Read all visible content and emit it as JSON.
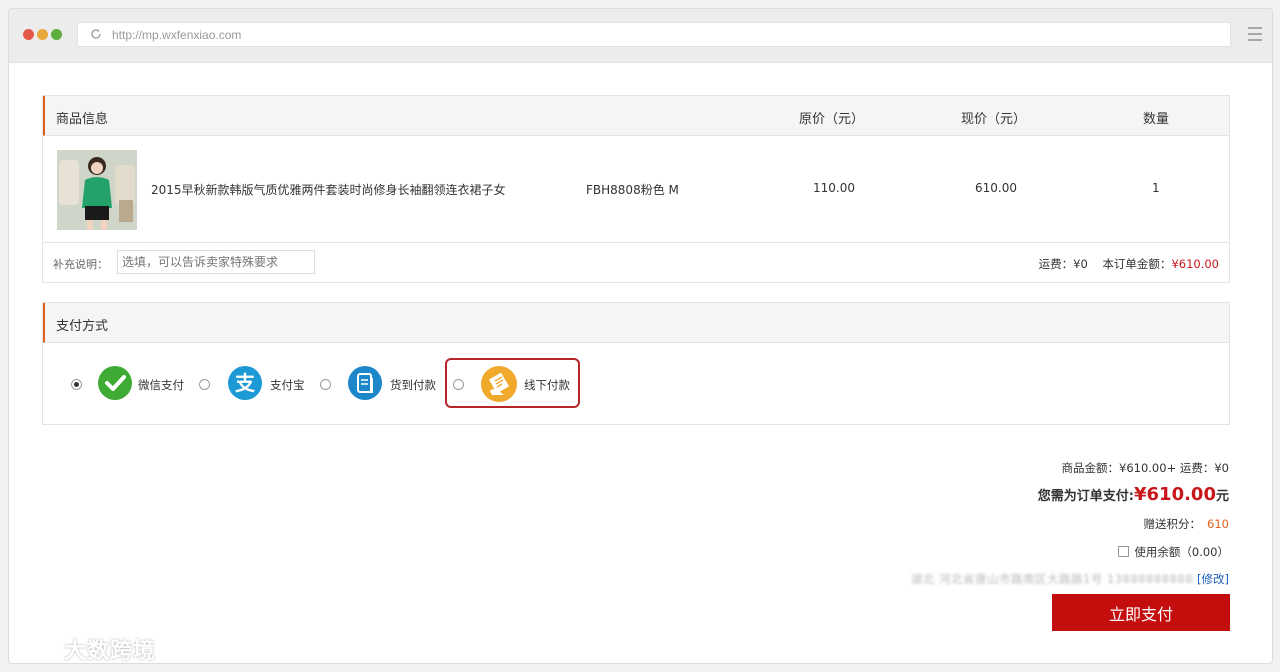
{
  "browser": {
    "url": "http://mp.wxfenxiao.com"
  },
  "product_table": {
    "headers": {
      "info": "商品信息",
      "original_price": "原价（元）",
      "current_price": "现价（元）",
      "quantity": "数量"
    },
    "item": {
      "title": "2015早秋新款韩版气质优雅两件套装时尚修身长袖翻领连衣裙子女",
      "sku": "FBH8808粉色 M",
      "original_price": "110.00",
      "current_price": "610.00",
      "quantity": "1"
    },
    "note_label": "补充说明：",
    "note_placeholder": "选填，可以告诉卖家特殊要求",
    "shipping_label": "运费：",
    "shipping_value": "¥0",
    "order_total_label": "本订单金额：",
    "order_total_value": "¥610.00"
  },
  "payment": {
    "title": "支付方式",
    "methods": [
      {
        "label": "微信支付",
        "icon": "wechat-pay-icon",
        "color": "#3fab35",
        "selected": true
      },
      {
        "label": "支付宝",
        "icon": "alipay-icon",
        "color": "#1d9ad6",
        "selected": false
      },
      {
        "label": "货到付款",
        "icon": "cash-on-delivery-icon",
        "color": "#1d88c9",
        "selected": false
      },
      {
        "label": "线下付款",
        "icon": "offline-payment-icon",
        "color": "#f0a92a",
        "selected": false
      }
    ]
  },
  "summary": {
    "goods_line": "商品金额：¥610.00+ 运费：¥0",
    "pay_label": "您需为订单支付:",
    "pay_amount": "¥610.00",
    "pay_unit": "元",
    "points_label": "赠送积分：",
    "points_value": "610",
    "balance_label": "使用余额（0.00）",
    "address": "湖北 河北省唐山市路南区大路路1号 13888888888",
    "edit_link": "[修改]"
  },
  "pay_button": "立即支付",
  "watermark": "大数跨境",
  "colors": {
    "accent": "#e2601c",
    "price_red": "#c8171b",
    "button_red": "#c40e0e",
    "highlight_border": "#b7252a"
  }
}
